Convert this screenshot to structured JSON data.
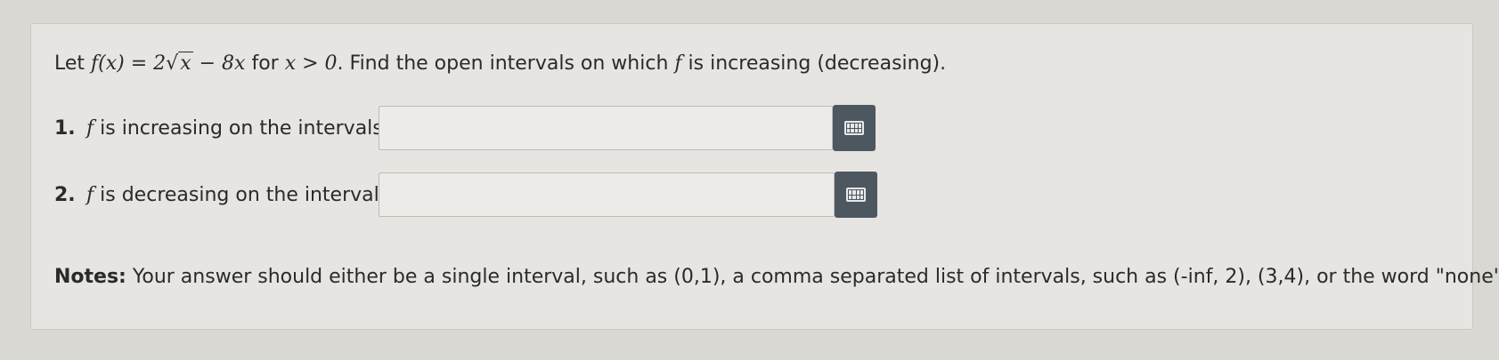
{
  "problem": {
    "intro": "Let",
    "func_lhs": "f(x) = 2",
    "radicand": "x",
    "func_rhs": " − 8x",
    "for_text": " for ",
    "condition": "x > 0",
    "question": ". Find the open intervals on which ",
    "f_symbol": "f",
    "question_end": " is increasing (decreasing)."
  },
  "items": [
    {
      "number": "1.",
      "f_symbol": "f",
      "label": " is increasing on the intervals",
      "input_value": "",
      "button_icon": "keyboard-icon"
    },
    {
      "number": "2.",
      "f_symbol": "f",
      "label": " is decreasing on the intervals",
      "input_value": "",
      "button_icon": "keyboard-icon"
    }
  ],
  "notes": {
    "heading": "Notes:",
    "text": " Your answer should either be a single interval, such as (0,1), a comma separated list of intervals, such as (-inf, 2), (3,4), or the word \"none\"."
  },
  "colors": {
    "background": "#d9d8d3",
    "card": "#e6e5e1",
    "button": "#4d5760"
  }
}
